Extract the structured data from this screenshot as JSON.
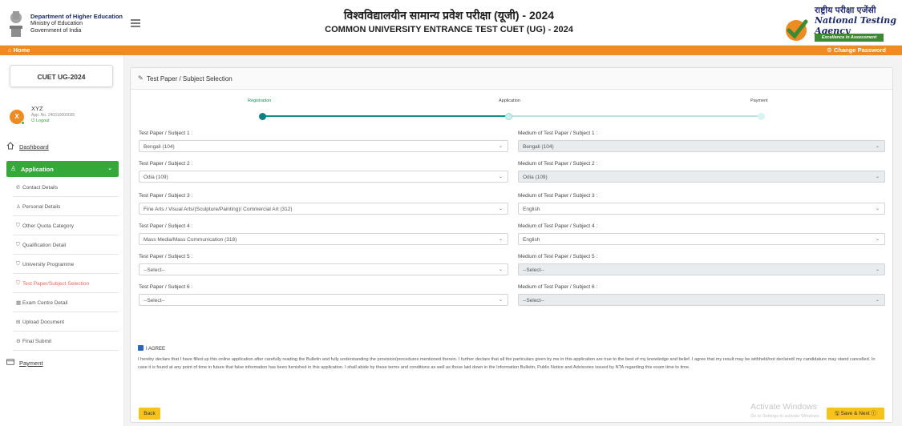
{
  "header": {
    "dept_line1": "Department of Higher Education",
    "dept_line2": "Ministry of Education",
    "dept_line3": "Government of India",
    "title_hindi": "विश्वविद्यालयीन सामान्य प्रवेश परीक्षा (यूजी) - 2024",
    "title_english": "COMMON UNIVERSITY ENTRANCE TEST CUET (UG) - 2024",
    "nta_hindi": "राष्ट्रीय परीक्षा एजेंसी",
    "nta_english": "National Testing Agency",
    "nta_tagline": "Excellence in Assessment"
  },
  "topbar": {
    "home": "⌂ Home",
    "change_password": "⚙ Change Password"
  },
  "sidebar": {
    "exam": "CUET UG-2024",
    "user_initial": "X",
    "user_name": "XYZ",
    "app_no": "App. No. 240310000035",
    "logout": "⏻ Logout",
    "dashboard": "Dashboard",
    "application": "Application",
    "payment": "Payment",
    "items": [
      {
        "label": "Contact Details",
        "icon": "phone-icon",
        "glyph": "✆"
      },
      {
        "label": "Personal Details",
        "icon": "person-icon",
        "glyph": "♙"
      },
      {
        "label": "Other Quota Category",
        "icon": "shield-icon",
        "glyph": "⛉"
      },
      {
        "label": "Qualification Detail",
        "icon": "shield-icon",
        "glyph": "⛉"
      },
      {
        "label": "University Programme",
        "icon": "shield-icon",
        "glyph": "⛉"
      },
      {
        "label": "Test Paper/Subject Selection",
        "icon": "shield-icon",
        "glyph": "⛉"
      },
      {
        "label": "Exam Centre Detail",
        "icon": "building-icon",
        "glyph": "▦"
      },
      {
        "label": "Upload Document",
        "icon": "upload-icon",
        "glyph": "⊞"
      },
      {
        "label": "Final Submit",
        "icon": "gear-icon",
        "glyph": "⚙"
      }
    ]
  },
  "card": {
    "title": "Test Paper / Subject Selection",
    "steps": [
      "Registration",
      "Application",
      "Payment"
    ],
    "rows": [
      {
        "subject_label": "Test Paper / Subject 1 :",
        "subject_value": "Bengali (104)",
        "medium_label": "Medium of Test Paper / Subject 1 :",
        "medium_value": "Bengali (104)"
      },
      {
        "subject_label": "Test Paper / Subject 2 :",
        "subject_value": "Odia (109)",
        "medium_label": "Medium of Test Paper / Subject 2 :",
        "medium_value": "Odia (109)"
      },
      {
        "subject_label": "Test Paper / Subject 3 :",
        "subject_value": "Fine Arts / Visual Arts/(Sculpture/Painting)/ Commercial Art (312)",
        "medium_label": "Medium of Test Paper / Subject 3 :",
        "medium_value": "English"
      },
      {
        "subject_label": "Test Paper / Subject 4 :",
        "subject_value": "Mass Media/Mass Communication (318)",
        "medium_label": "Medium of Test Paper / Subject 4 :",
        "medium_value": "English"
      },
      {
        "subject_label": "Test Paper / Subject 5 :",
        "subject_value": "--Select--",
        "medium_label": "Medium of Test Paper / Subject 5 :",
        "medium_value": "--Select--"
      },
      {
        "subject_label": "Test Paper / Subject 6 :",
        "subject_value": "--Select--",
        "medium_label": "Medium of Test Paper / Subject 6 :",
        "medium_value": "--Select--"
      }
    ],
    "agree_label": "I AGREE",
    "declaration": "I hereby declare that I have filled up this online application after carefully reading the Bulletin and fully understanding the provision/procedures mentioned therein. I further declare that all the particulars given by me in this application are true to the best of my knowledge and belief. I agree that my result may be withheld/not declared/ my candidature may stand cancelled. In case it is found at any point of time in future that false information has been furnished in this application. I shall abide by these terms and conditions as well as those laid down in the Information Bulletin, Public Notice and Advisories issued by NTA regarding this exam time to time.",
    "back": "Back",
    "save_next": "🖫 Save & Next ⓘ"
  },
  "watermark": {
    "line1": "Activate Windows",
    "line2": "Go to Settings to activate Windows."
  },
  "colors": {
    "accent_orange": "#ef8b23",
    "sidebar_green": "#35a83a",
    "step_teal": "#0f8f8f",
    "button_yellow": "#f7c21a"
  }
}
